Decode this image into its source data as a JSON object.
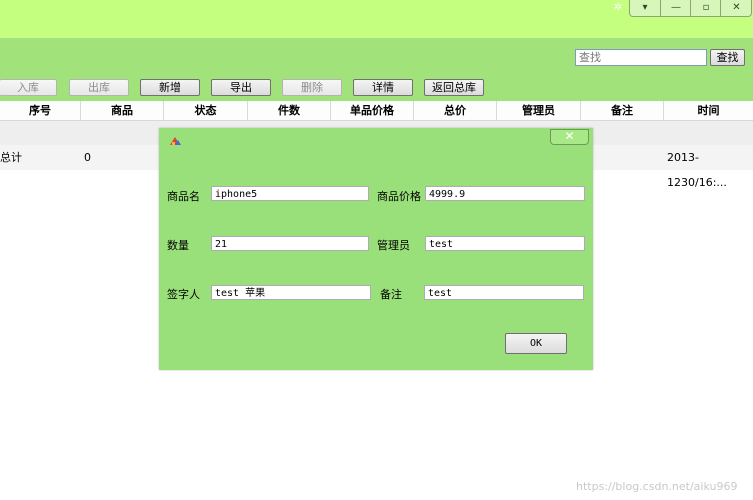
{
  "window": {
    "pin_icon": "✲",
    "controls": [
      {
        "name": "dropdown-control",
        "glyph": "▾"
      },
      {
        "name": "minimize-control",
        "glyph": "—"
      },
      {
        "name": "maximize-control",
        "glyph": "▫"
      },
      {
        "name": "close-control",
        "glyph": "✕"
      }
    ]
  },
  "search": {
    "placeholder": "查找",
    "button": "查找"
  },
  "toolbar": {
    "buttons": [
      {
        "label": "入库",
        "enabled": false
      },
      {
        "label": "出库",
        "enabled": false
      },
      {
        "label": "新增",
        "enabled": true
      },
      {
        "label": "导出",
        "enabled": true
      },
      {
        "label": "删除",
        "enabled": false
      },
      {
        "label": "详情",
        "enabled": true
      },
      {
        "label": "返回总库",
        "enabled": true
      }
    ]
  },
  "table": {
    "columns": [
      "序号",
      "商品",
      "状态",
      "件数",
      "单品价格",
      "总价",
      "管理员",
      "备注",
      "时间"
    ],
    "summary_row": {
      "label": "总计",
      "count": "0",
      "time": "2013-1230/16:..."
    }
  },
  "dialog": {
    "close_glyph": "✕",
    "fields": {
      "product_label": "商品名",
      "product_value": "iphone5",
      "price_label": "商品价格",
      "price_value": "4999.9",
      "qty_label": "数量",
      "qty_value": "21",
      "admin_label": "管理员",
      "admin_value": "test",
      "signer_label": "签字人",
      "signer_value": "test 苹果",
      "note_label": "备注",
      "note_value": "test"
    },
    "ok_label": "OK"
  },
  "watermark": "https://blog.csdn.net/aiku969",
  "colors": {
    "title_band": "#c4ff80",
    "toolbar": "#a1e37a",
    "dialog": "#9ae07a"
  }
}
